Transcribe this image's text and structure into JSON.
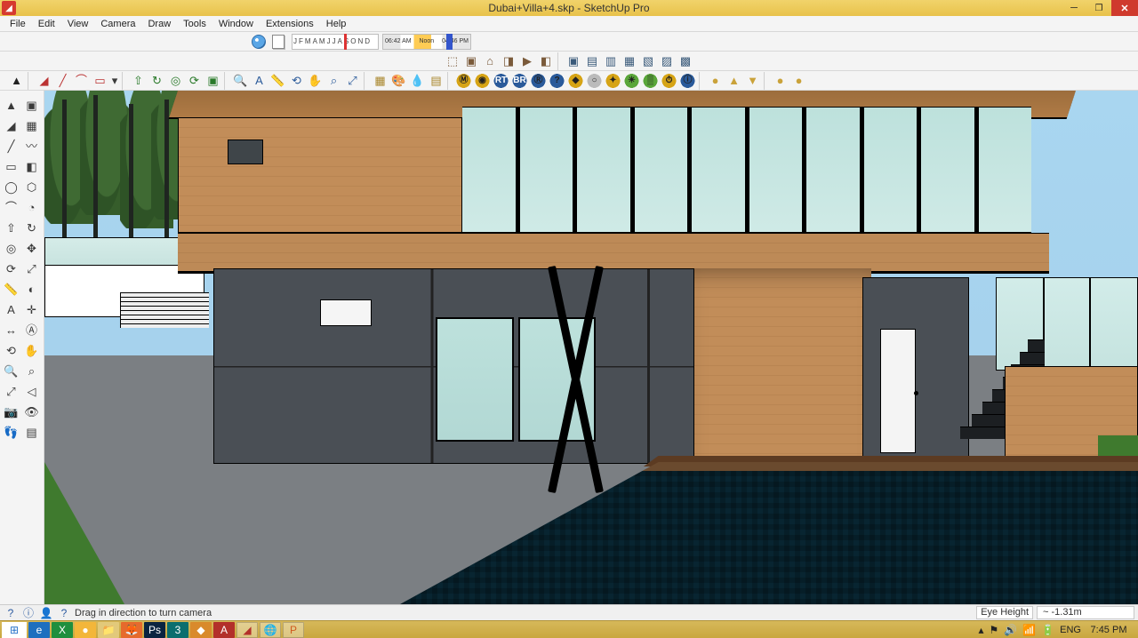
{
  "app_name": "SketchUp Pro",
  "file_name": "Dubai+Villa+4.skp",
  "titlebar": {
    "title": "Dubai+Villa+4.skp - SketchUp Pro"
  },
  "window_controls": {
    "min": "Minimize",
    "max": "Restore",
    "close": "Close"
  },
  "menus": [
    "File",
    "Edit",
    "View",
    "Camera",
    "Draw",
    "Tools",
    "Window",
    "Extensions",
    "Help"
  ],
  "shadow_bar": {
    "months": [
      "J",
      "F",
      "M",
      "A",
      "M",
      "J",
      "J",
      "A",
      "S",
      "O",
      "N",
      "D"
    ],
    "sunrise": "06:42 AM",
    "noon": "Noon",
    "sunset": "04:46 PM"
  },
  "status": {
    "hint": "Drag in direction to turn camera",
    "field_label": "Eye Height",
    "field_value": "~ -1.31m"
  },
  "toolbar_row3_tips": [
    "3D Warehouse Group",
    "Component",
    "Home",
    "Scene Prev",
    "Scene Play",
    "Scene Next",
    "Copy",
    "Layers",
    "Stack",
    "Components",
    "Outliner",
    "Paste",
    "Materials"
  ],
  "toolbar_row4_groups": {
    "g1": [
      "Select"
    ],
    "g2": [
      "Eraser",
      "Line",
      "Arc",
      "Rectangle",
      "Shapes"
    ],
    "g3": [
      "Push/Pull",
      "Follow Me",
      "Offset",
      "Rotate",
      "Scale"
    ],
    "g4": [
      "Tape",
      "Text",
      "Dimension",
      "Protractor",
      "Axes",
      "Section"
    ],
    "g5": [
      "Orbit",
      "Pan",
      "Zoom",
      "Zoom Extents"
    ],
    "g6": [
      "Map",
      "Paint",
      "Sample",
      "3D Text"
    ],
    "vray": [
      "V-Ray",
      "Dome",
      "RT",
      "Batch",
      "Render",
      "Help",
      "Light",
      "Sphere",
      "IES",
      "Sun",
      "Fur",
      "Proxy",
      "Clock",
      "Info"
    ],
    "g8": [
      "Sun",
      "Up",
      "Down",
      "ToGround",
      "Ball",
      "Bulb"
    ]
  },
  "left_tools": [
    "select-tool",
    "component-tool",
    "eraser-tool",
    "paint-bucket-tool",
    "line-tool",
    "freehand-tool",
    "rectangle-tool",
    "rotated-rect-tool",
    "circle-tool",
    "polygon-tool",
    "arc-tool",
    "pie-tool",
    "pushpull-tool",
    "followme-tool",
    "offset-tool",
    "move-tool",
    "rotate-tool",
    "scale-tool",
    "tape-tool",
    "protractor-tool",
    "text-tool",
    "axes-tool",
    "dimension-tool",
    "3dtext-tool",
    "orbit-tool",
    "pan-tool",
    "zoom-tool",
    "zoom-window-tool",
    "zoom-extents-tool",
    "previous-tool",
    "position-camera-tool",
    "look-around-tool",
    "walk-tool",
    "section-tool"
  ],
  "left_glyphs": [
    "▲",
    "▣",
    "◢",
    "▦",
    "╱",
    "〰",
    "▭",
    "◧",
    "◯",
    "⬡",
    "⌒",
    "◔",
    "⇧",
    "↻",
    "◎",
    "✥",
    "⟳",
    "⤢",
    "📏",
    "◐",
    "A",
    "✛",
    "↔",
    "Ⓐ",
    "⟲",
    "✋",
    "🔍",
    "⌕",
    "⤢",
    "◁",
    "📷",
    "👁",
    "👣",
    "▤"
  ],
  "row4_glyphs_g1": [
    "▲"
  ],
  "row4_glyphs_g2": [
    "◢",
    "╱",
    "⌒",
    "▭",
    "▾"
  ],
  "row4_glyphs_g3": [
    "⇧",
    "↻",
    "◎",
    "⟳",
    "▣"
  ],
  "row4_glyphs_g4": [
    "🔍",
    "A",
    "📏",
    "⟲",
    "✋",
    "⌕"
  ],
  "row4_glyphs_g5": [
    "⤢"
  ],
  "row4_glyphs_g6": [
    "▦",
    "🎨",
    "💧",
    "▤"
  ],
  "row4_glyphs_vray": [
    "Ⓜ",
    "◉",
    "RT",
    "BR",
    "Ⓡ",
    "?",
    "◆",
    "○",
    "✦",
    "☀",
    "▒",
    "⏱",
    "ⓘ"
  ],
  "row4_glyphs_g8": [
    "●",
    "▲",
    "▼",
    "⬇",
    "●",
    "●"
  ],
  "row3_glyphs": [
    "⬚",
    "▣",
    "⌂",
    "◨",
    "▶",
    "◧",
    "▣",
    "▤",
    "▥",
    "▦",
    "▧",
    "▨",
    "▩"
  ],
  "taskbar": {
    "apps": [
      "ie",
      "excel",
      "chrome",
      "explorer",
      "firefox",
      "photoshop",
      "3dsmax",
      "revit",
      "autocad",
      "sketchup",
      "chrome2",
      "powerpoint"
    ],
    "tray_icons": [
      "flag",
      "speaker",
      "network",
      "battery"
    ],
    "lang": "ENG",
    "clock": "7:45 PM"
  }
}
